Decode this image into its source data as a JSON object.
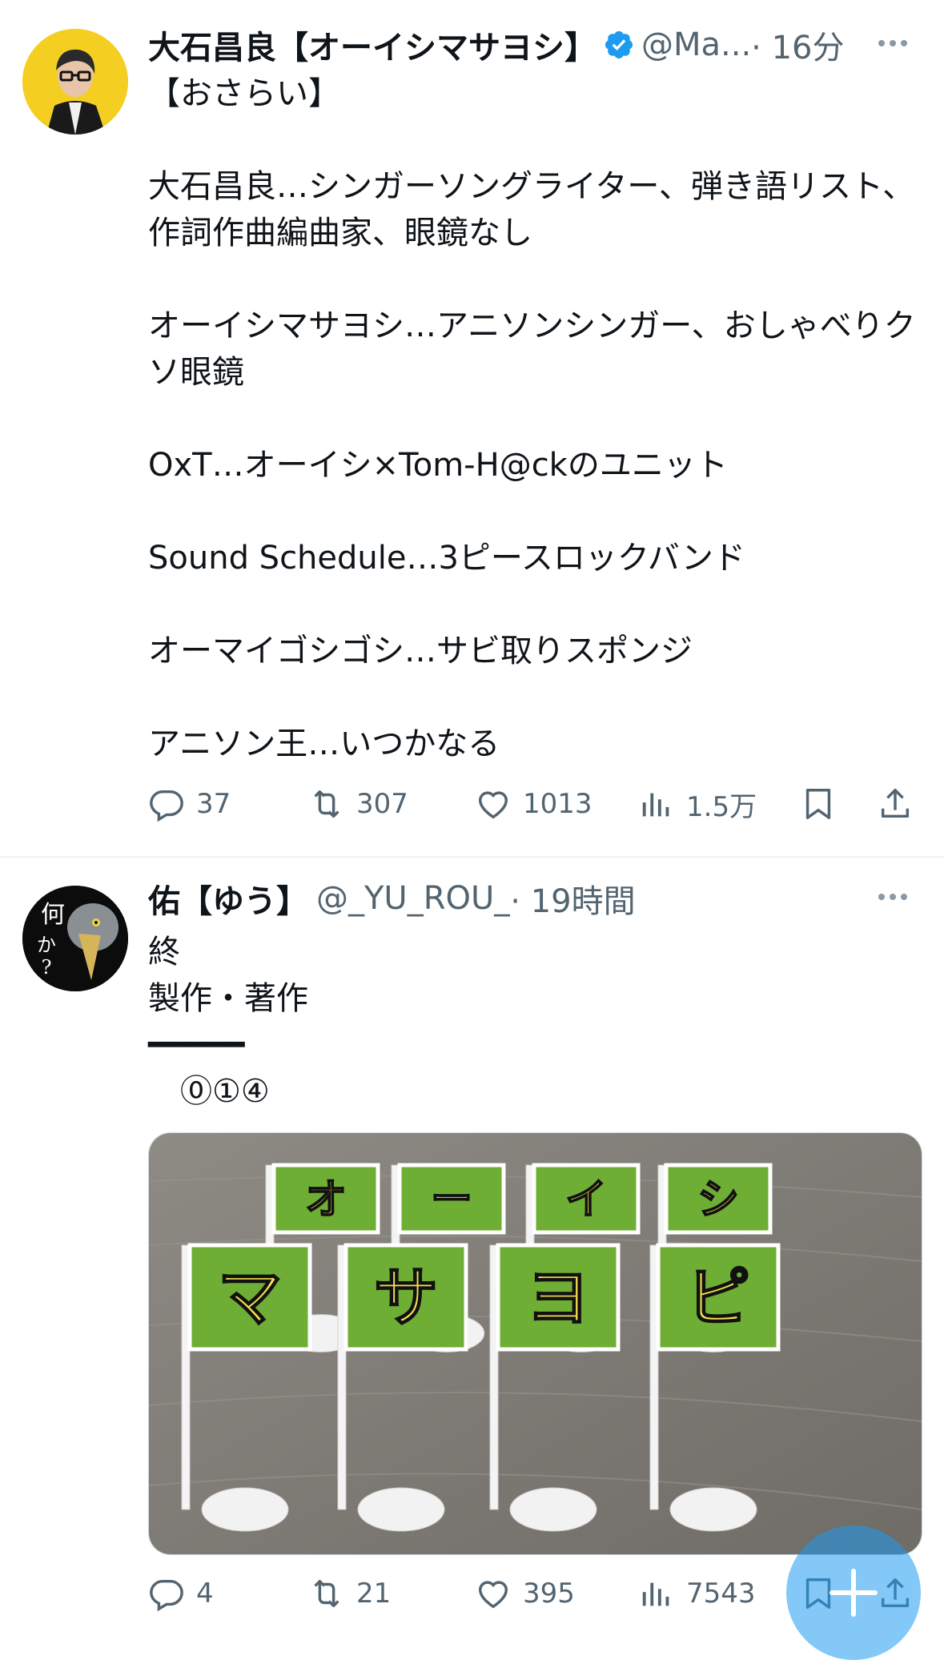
{
  "tweets": [
    {
      "author_name": "大石昌良【オーイシマサヨシ】",
      "handle": "@Ma...",
      "time": "· 16分",
      "body": "【おさらい】\n\n大石昌良…シンガーソングライター、弾き語リスト、作詞作曲編曲家、眼鏡なし\n\nオーイシマサヨシ…アニソンシンガー、おしゃべりクソ眼鏡\n\nOxT…オーイシ×Tom-H@ckのユニット\n\nSound Schedule…3ピースロックバンド\n\nオーマイゴシゴシ…サビ取りスポンジ\n\nアニソン王…いつかなる",
      "replies": "37",
      "retweets": "307",
      "likes": "1013",
      "views": "1.5万"
    },
    {
      "author_name": "佑【ゆう】",
      "handle": "@_YU_ROU_",
      "time": "· 19時間",
      "avatar_text": "何か?",
      "body": "終\n製作・著作\n━━━━━\n　⓪①④",
      "image_flags_top": [
        "オ",
        "ー",
        "イ",
        "シ"
      ],
      "image_flags_bottom": [
        "マ",
        "サ",
        "ヨ",
        "ピ"
      ],
      "replies": "4",
      "retweets": "21",
      "likes": "395",
      "views": "7543"
    }
  ],
  "colors": {
    "accent": "#1d9bf0",
    "text": "#0f1419",
    "muted": "#536471",
    "flag_green": "#6fae34",
    "flag_text": "#f4e04d"
  },
  "icons": [
    "verified-badge-icon",
    "more-icon",
    "reply-icon",
    "retweet-icon",
    "like-icon",
    "views-icon",
    "bookmark-icon",
    "share-icon",
    "compose-icon"
  ]
}
